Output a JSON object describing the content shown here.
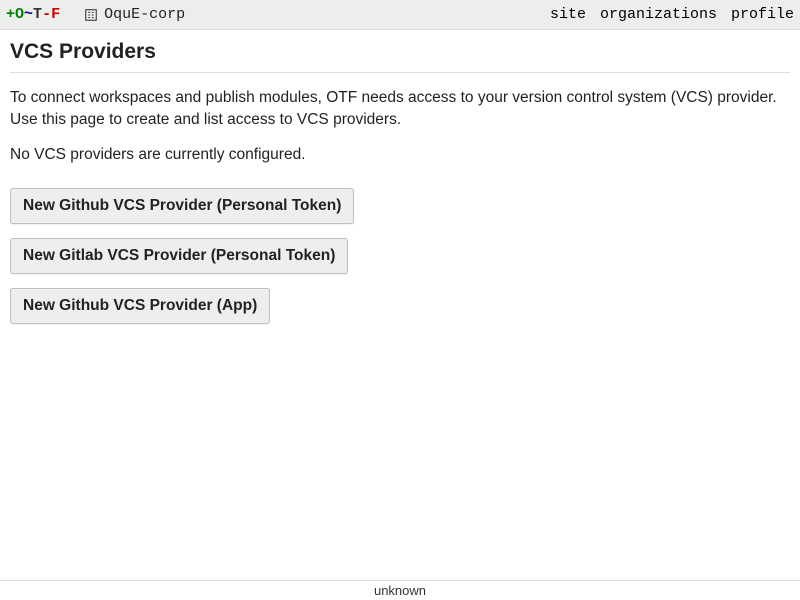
{
  "header": {
    "logo_parts": {
      "plus": "+",
      "o": "O",
      "tilde": "~",
      "t": "T",
      "dash": "-",
      "f": "F"
    },
    "org_name": "OquE-corp",
    "nav": {
      "site": "site",
      "organizations": "organizations",
      "profile": "profile"
    }
  },
  "page": {
    "title": "VCS Providers",
    "description": "To connect workspaces and publish modules, OTF needs access to your version control system (VCS) provider. Use this page to create and list access to VCS providers.",
    "empty_message": "No VCS providers are currently configured."
  },
  "buttons": {
    "github_token": "New Github VCS Provider (Personal Token)",
    "gitlab_token": "New Gitlab VCS Provider (Personal Token)",
    "github_app": "New Github VCS Provider (App)"
  },
  "footer": {
    "version": "unknown"
  }
}
